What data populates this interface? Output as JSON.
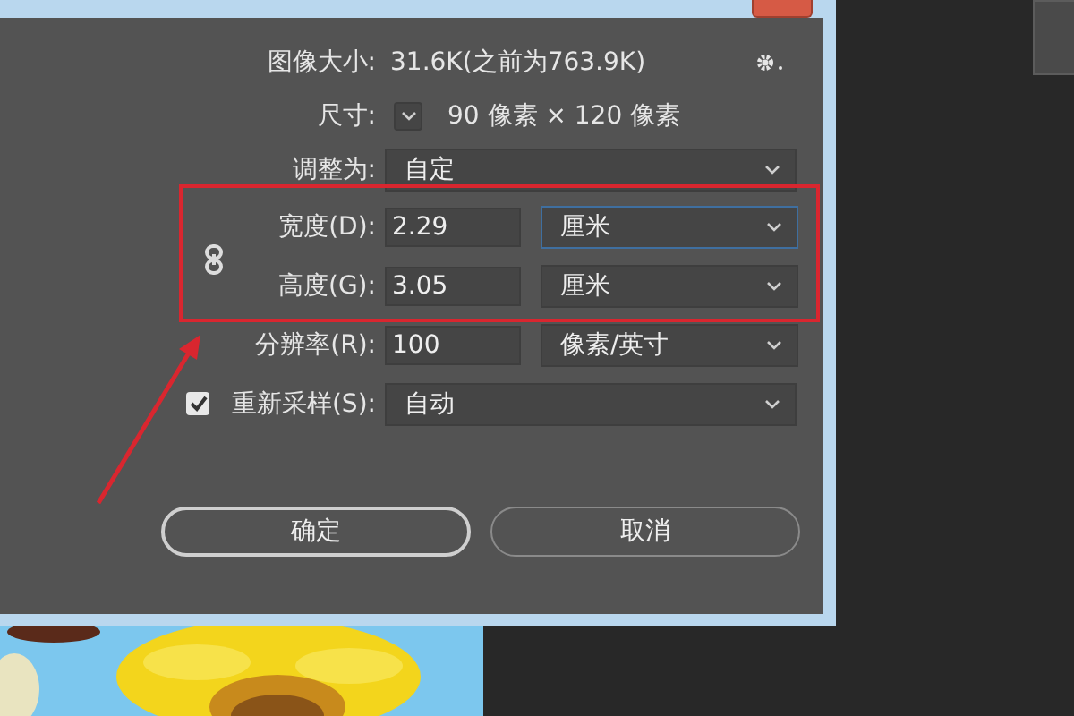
{
  "image_size": {
    "label": "图像大小:",
    "value": "31.6K(之前为763.9K)"
  },
  "dimensions": {
    "label": "尺寸:",
    "value": "90 像素 × 120 像素"
  },
  "fit_to": {
    "label": "调整为:",
    "value": "自定"
  },
  "fields": [
    {
      "label": "宽度(D):",
      "value": "2.29",
      "unit": "厘米",
      "focused": true
    },
    {
      "label": "高度(G):",
      "value": "3.05",
      "unit": "厘米",
      "focused": false
    },
    {
      "label": "分辨率(R):",
      "value": "100",
      "unit": "像素/英寸",
      "focused": false
    }
  ],
  "resample": {
    "label": "重新采样(S):",
    "checked": true,
    "value": "自动"
  },
  "buttons": [
    {
      "label": "确定",
      "kind": "primary"
    },
    {
      "label": "取消",
      "kind": "secondary"
    }
  ]
}
